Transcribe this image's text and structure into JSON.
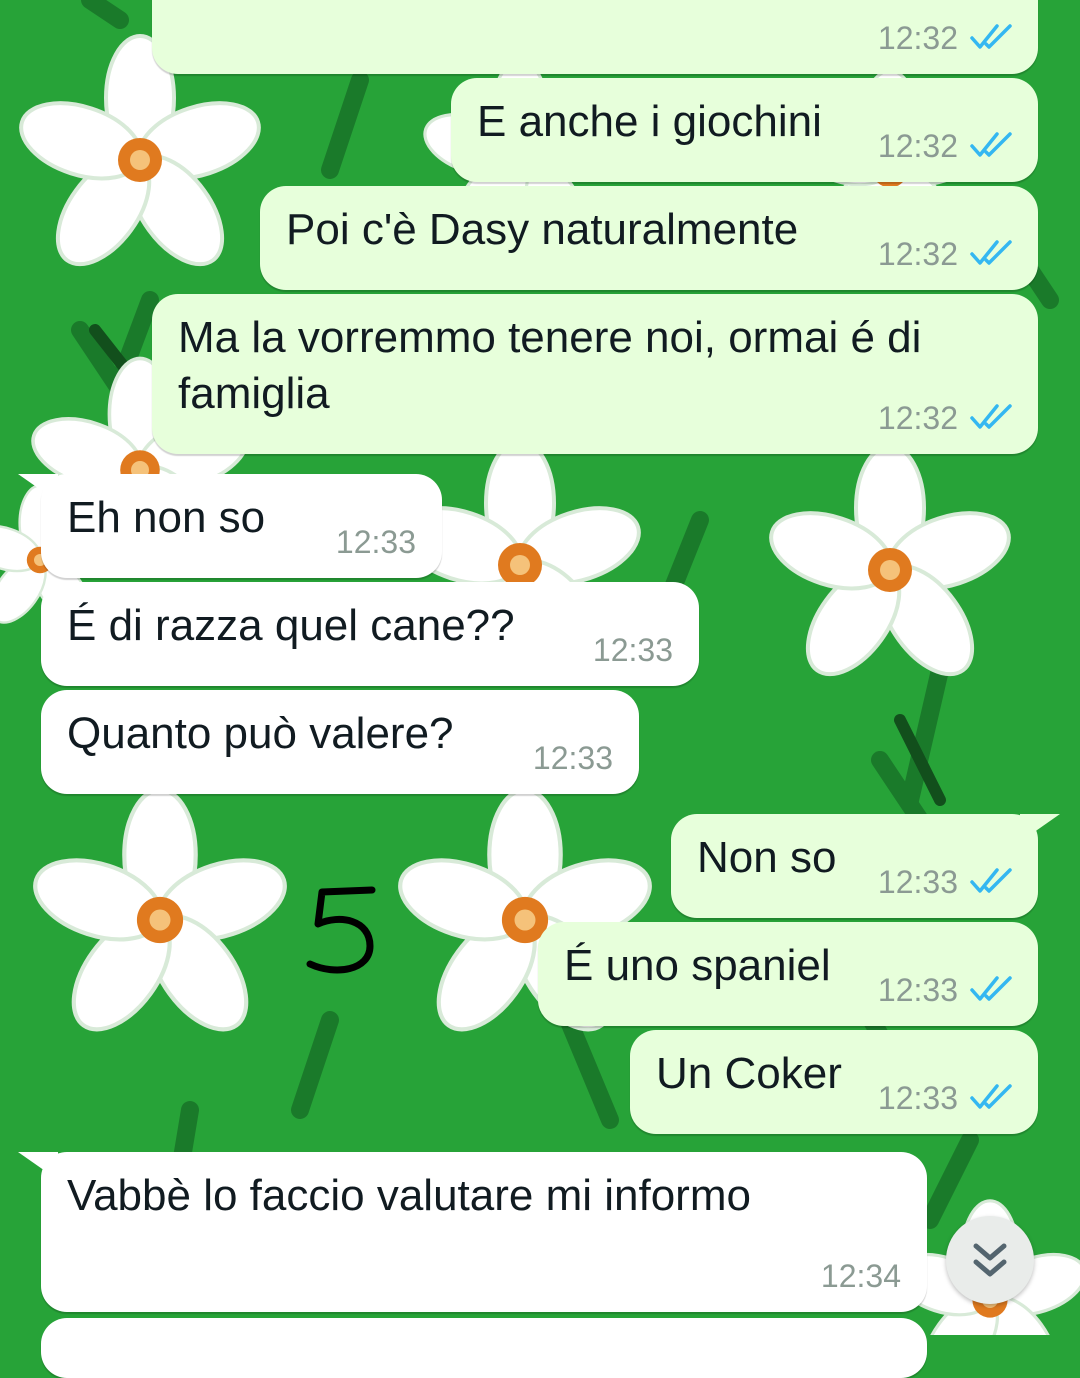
{
  "theme": {
    "wallpaper_color": "#27a338",
    "outgoing_bubble": "#e7ffdb",
    "incoming_bubble": "#ffffff",
    "read_tick_color": "#34b7f1",
    "timestamp_color": "#8b9a93"
  },
  "messages": [
    {
      "direction": "out",
      "text": "",
      "time": "12:32",
      "status": "read"
    },
    {
      "direction": "out",
      "text": "E anche i giochini",
      "time": "12:32",
      "status": "read"
    },
    {
      "direction": "out",
      "text": "Poi c'è Dasy naturalmente",
      "time": "12:32",
      "status": "read"
    },
    {
      "direction": "out",
      "text_line1": "Ma la vorremmo tenere noi, ormai é di",
      "text_line2": "famiglia",
      "time": "12:32",
      "status": "read"
    },
    {
      "direction": "in",
      "text": "Eh non so",
      "time": "12:33"
    },
    {
      "direction": "in",
      "text": "É di razza quel cane??",
      "time": "12:33"
    },
    {
      "direction": "in",
      "text": "Quanto può valere?",
      "time": "12:33"
    },
    {
      "direction": "out",
      "text": "Non so",
      "time": "12:33",
      "status": "read"
    },
    {
      "direction": "out",
      "text": "É uno spaniel",
      "time": "12:33",
      "status": "read"
    },
    {
      "direction": "out",
      "text": "Un Coker",
      "time": "12:33",
      "status": "read"
    },
    {
      "direction": "in",
      "text": "Vabbè lo faccio valutare mi informo",
      "time": "12:34"
    }
  ],
  "overlay_annotation": "5",
  "scroll_button": {
    "icon": "double-chevron-down-icon"
  }
}
